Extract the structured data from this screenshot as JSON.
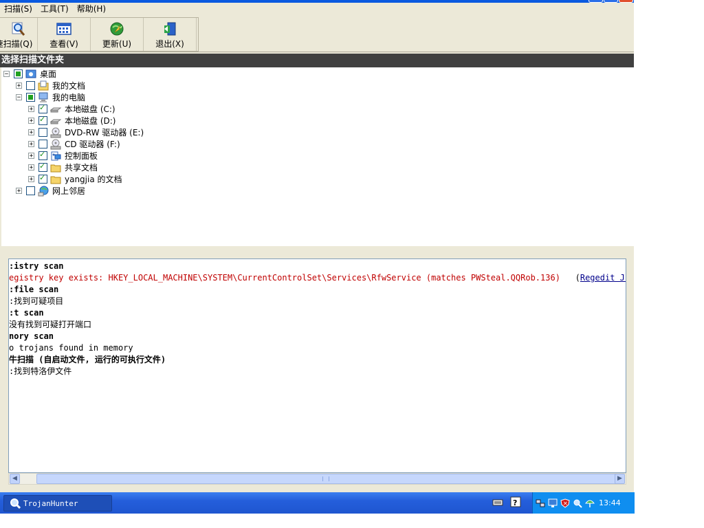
{
  "menu": [
    "扫描(S)",
    "工具(T)",
    "帮助(H)"
  ],
  "toolbar": {
    "scan": "速扫描(Q)",
    "view": "查看(V)",
    "update": "更新(U)",
    "exit": "退出(X)"
  },
  "section_title": "选择扫描文件夹",
  "tree": {
    "desktop": "桌面",
    "my_documents": "我的文档",
    "my_computer": "我的电脑",
    "local_c": "本地磁盘 (C:)",
    "local_d": "本地磁盘 (D:)",
    "dvd": "DVD-RW 驱动器 (E:)",
    "cd": "CD 驱动器 (F:)",
    "control_panel": "控制面板",
    "shared_docs": "共享文档",
    "user_docs": "yangjia 的文档",
    "network": "网上邻居"
  },
  "output": {
    "l1": ":istry scan",
    "l2": "egistry key exists: HKEY_LOCAL_MACHINE\\SYSTEM\\CurrentControlSet\\Services\\RfwService (matches PWSteal.QQRob.136)",
    "l2_paren_open": "(",
    "l2_link": "Regedit Jump",
    "l2_paren_close": ")",
    "l3": ":file scan",
    "l4": ":找到可疑项目",
    "l5": ":t scan",
    "l6": "没有找到可疑打开端口",
    "l7": "nory scan",
    "l8": "o trojans found in memory",
    "l9": "牛扫描 (自启动文件, 运行的可执行文件)",
    "l10": ":找到特洛伊文件"
  },
  "taskbar": {
    "task": "TrojanHunter",
    "clock": "13:44"
  },
  "colors": {
    "section_header_bg": "#404040",
    "registry_warning": "#c00000",
    "link": "#00008b",
    "taskbar": "#245edb"
  }
}
